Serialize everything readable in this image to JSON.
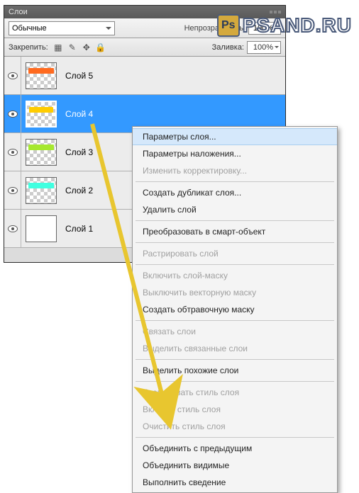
{
  "watermark": {
    "icon": "Ps",
    "text": "PSAND.RU"
  },
  "panel": {
    "title": "Слои",
    "blend_mode": "Обычные",
    "opacity_label": "Непрозрачность:",
    "opacity_value": "100%",
    "lock_label": "Закрепить:",
    "fill_label": "Заливка:",
    "fill_value": "100%",
    "layers": [
      {
        "name": "Слой 5",
        "color": "#ff6a1f",
        "selected": false,
        "white": false
      },
      {
        "name": "Слой 4",
        "color": "#ffcc00",
        "selected": true,
        "white": false
      },
      {
        "name": "Слой 3",
        "color": "#a6e82e",
        "selected": false,
        "white": false
      },
      {
        "name": "Слой 2",
        "color": "#3fffe0",
        "selected": false,
        "white": false
      },
      {
        "name": "Слой 1",
        "color": "",
        "selected": false,
        "white": true
      }
    ]
  },
  "context_menu": {
    "items": [
      {
        "label": "Параметры слоя...",
        "hover": true
      },
      {
        "label": "Параметры наложения..."
      },
      {
        "label": "Изменить корректировку...",
        "disabled": true
      },
      {
        "sep": true
      },
      {
        "label": "Создать дубликат слоя..."
      },
      {
        "label": "Удалить слой"
      },
      {
        "sep": true
      },
      {
        "label": "Преобразовать в смарт-объект"
      },
      {
        "sep": true
      },
      {
        "label": "Растрировать слой",
        "disabled": true
      },
      {
        "sep": true
      },
      {
        "label": "Включить слой-маску",
        "disabled": true
      },
      {
        "label": "Выключить векторную маску",
        "disabled": true
      },
      {
        "label": "Создать обтравочную маску"
      },
      {
        "sep": true
      },
      {
        "label": "Связать слои",
        "disabled": true
      },
      {
        "label": "Выделить связанные слои",
        "disabled": true
      },
      {
        "sep": true
      },
      {
        "label": "Выделить похожие слои"
      },
      {
        "sep": true
      },
      {
        "label": "Скопировать стиль слоя",
        "disabled": true
      },
      {
        "label": "Вклеить стиль слоя",
        "disabled": true
      },
      {
        "label": "Очистить стиль слоя",
        "disabled": true
      },
      {
        "sep": true
      },
      {
        "label": "Объединить с предыдущим"
      },
      {
        "label": "Объединить видимые"
      },
      {
        "label": "Выполнить сведение"
      }
    ]
  }
}
